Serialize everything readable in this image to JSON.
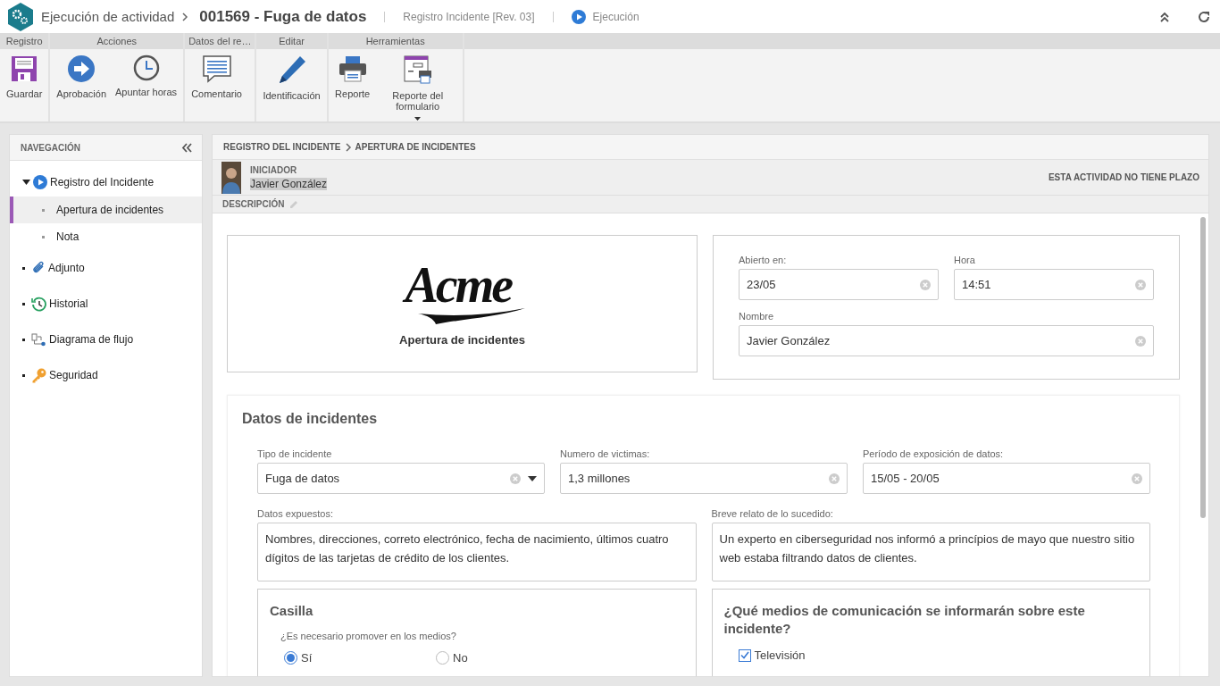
{
  "header": {
    "title": "Ejecución de actividad",
    "record": "001569 - Fuga de datos",
    "process": "Registro Incidente [Rev. 03]",
    "status": "Ejecución"
  },
  "ribbon": {
    "groups": [
      {
        "label": "Registro",
        "buttons": [
          {
            "label": "Guardar",
            "kind": "save"
          }
        ]
      },
      {
        "label": "Acciones",
        "buttons": [
          {
            "label": "Aprobación",
            "kind": "forward"
          },
          {
            "label": "Apuntar horas",
            "kind": "clock"
          }
        ]
      },
      {
        "label": "Datos del re…",
        "buttons": [
          {
            "label": "Comentario",
            "kind": "comment"
          }
        ]
      },
      {
        "label": "Editar",
        "buttons": [
          {
            "label": "Identificación",
            "kind": "pencil"
          }
        ]
      },
      {
        "label": "Herramientas",
        "buttons": [
          {
            "label": "Reporte",
            "kind": "printer"
          },
          {
            "label": "Reporte del formulario",
            "kind": "form-report",
            "dropdown": true
          }
        ]
      }
    ]
  },
  "navigation": {
    "title": "NAVEGACIÓN",
    "items": [
      {
        "label": "Registro del Incidente",
        "kind": "play",
        "expanded": true,
        "children": [
          {
            "label": "Apertura de incidentes",
            "selected": true
          },
          {
            "label": "Nota",
            "selected": false
          }
        ]
      },
      {
        "label": "Adjunto",
        "kind": "clip"
      },
      {
        "label": "Historial",
        "kind": "history"
      },
      {
        "label": "Diagrama de flujo",
        "kind": "flow"
      },
      {
        "label": "Seguridad",
        "kind": "key"
      }
    ]
  },
  "main": {
    "breadcrumb": [
      "REGISTRO DEL INCIDENTE",
      "APERTURA DE INCIDENTES"
    ],
    "initiator": {
      "label": "INICIADOR",
      "name": "Javier González"
    },
    "deadline": "ESTA ACTIVIDAD NO TIENE PLAZO",
    "description_label": "DESCRIPCIÓN",
    "logo": {
      "text": "Acme",
      "caption": "Apertura de incidentes"
    },
    "header_fields": [
      {
        "label": "Abierto en:",
        "value": "23/05"
      },
      {
        "label": "Hora",
        "value": "14:51"
      },
      {
        "label": "Nombre",
        "value": "Javier González"
      }
    ],
    "section": {
      "title": "Datos de incidentes",
      "fields": [
        {
          "label": "Tipo de incidente",
          "value": "Fuga de datos",
          "kind": "select"
        },
        {
          "label": "Numero de victimas:",
          "value": "1,3 millones",
          "kind": "text"
        },
        {
          "label": "Período de exposición de datos:",
          "value": "15/05 - 20/05",
          "kind": "text"
        }
      ],
      "textareas": [
        {
          "label": "Datos expuestos:",
          "value": "Nombres, direcciones, correto electrónico, fecha de nacimiento, últimos cuatro dígitos de las tarjetas de crédito de los clientes."
        },
        {
          "label": "Breve relato de lo sucedido:",
          "value": "Un experto en ciberseguridad nos informó a princípios de mayo que nuestro sitio web estaba filtrando datos de clientes."
        }
      ],
      "casilla": {
        "title": "Casilla",
        "question": "¿Es necesario promover en los medios?",
        "options": [
          {
            "label": "Sí",
            "selected": true
          },
          {
            "label": "No",
            "selected": false
          }
        ]
      },
      "media": {
        "title": "¿Qué medios de comunicación se informarán sobre este incidente?",
        "options": [
          {
            "label": "Televisión",
            "checked": true
          }
        ]
      }
    }
  }
}
